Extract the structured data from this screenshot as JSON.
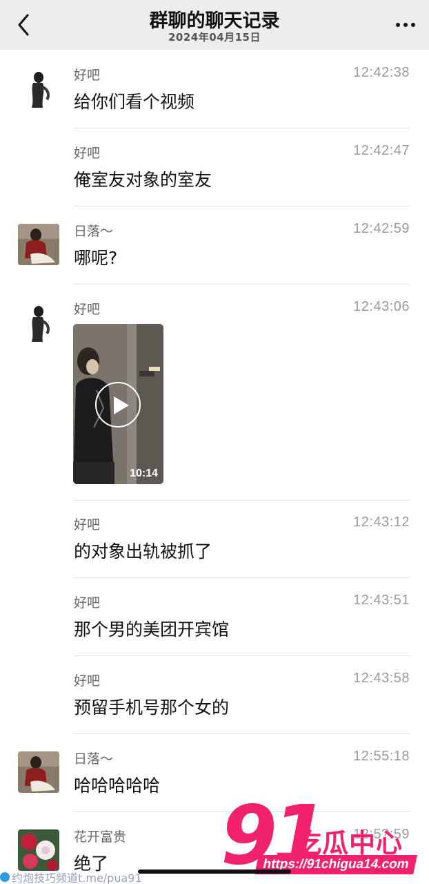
{
  "header": {
    "title": "群聊的聊天记录",
    "date": "2024年04月15日"
  },
  "messages": [
    {
      "sender": "好吧",
      "time": "12:42:38",
      "text": "给你们看个视频",
      "avatar": "silhouette"
    },
    {
      "sender": "好吧",
      "time": "12:42:47",
      "text": "俺室友对象的室友",
      "avatar": ""
    },
    {
      "sender": "日落～",
      "time": "12:42:59",
      "text": "哪呢?",
      "avatar": "person-red"
    },
    {
      "sender": "好吧",
      "time": "12:43:06",
      "text": "",
      "avatar": "silhouette",
      "video_duration": "10:14"
    },
    {
      "sender": "好吧",
      "time": "12:43:12",
      "text": "的对象出轨被抓了",
      "avatar": ""
    },
    {
      "sender": "好吧",
      "time": "12:43:51",
      "text": "那个男的美团开宾馆",
      "avatar": ""
    },
    {
      "sender": "好吧",
      "time": "12:43:58",
      "text": "预留手机号那个女的",
      "avatar": ""
    },
    {
      "sender": "日落～",
      "time": "12:55:18",
      "text": "哈哈哈哈哈",
      "avatar": "person-red"
    },
    {
      "sender": "花开富贵",
      "time": "12:5?:59",
      "text": "绝了",
      "avatar": "flowers"
    }
  ],
  "watermark": {
    "number": "91",
    "name": "吃瓜中心",
    "url": "https://91chigua14.com",
    "telegram_text": "约炮技巧频道t.me/pua91"
  },
  "colors": {
    "header_bg": "#ededed",
    "watermark": "#f2216e"
  },
  "icons": [
    "back-chevron-icon",
    "more-dots-icon",
    "play-icon"
  ]
}
